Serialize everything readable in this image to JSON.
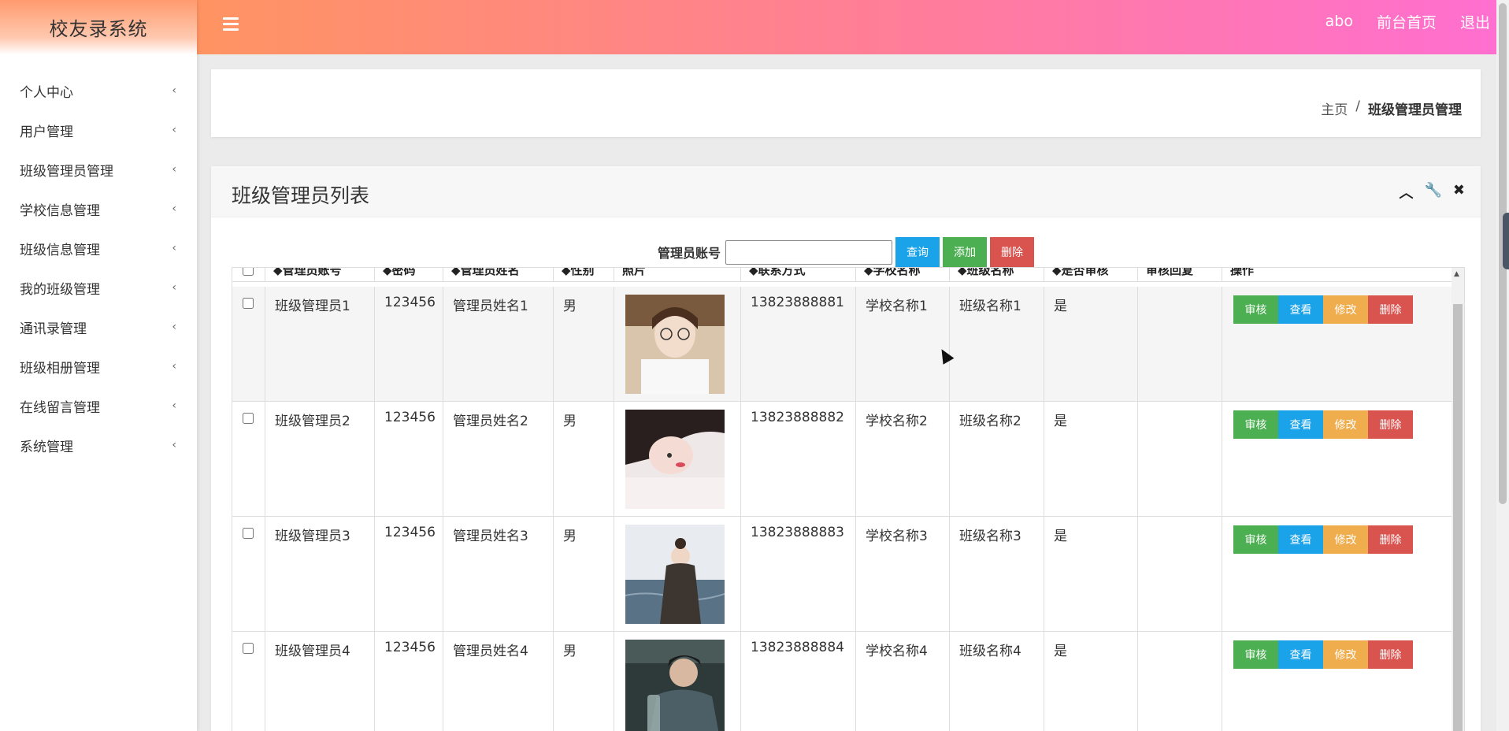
{
  "app": {
    "title": "校友录系统"
  },
  "sidebar": {
    "items": [
      {
        "label": "个人中心"
      },
      {
        "label": "用户管理"
      },
      {
        "label": "班级管理员管理"
      },
      {
        "label": "学校信息管理"
      },
      {
        "label": "班级信息管理"
      },
      {
        "label": "我的班级管理"
      },
      {
        "label": "通讯录管理"
      },
      {
        "label": "班级相册管理"
      },
      {
        "label": "在线留言管理"
      },
      {
        "label": "系统管理"
      }
    ],
    "chevron": "‹"
  },
  "header": {
    "user": "abo",
    "home_link": "前台首页",
    "logout": "退出"
  },
  "breadcrumb": {
    "home": "主页",
    "separator": "/",
    "current": "班级管理员管理"
  },
  "list": {
    "title": "班级管理员列表",
    "search": {
      "label": "管理员账号",
      "value": "",
      "query_btn": "查询",
      "add_btn": "添加",
      "delete_btn": "删除"
    },
    "columns": [
      "",
      "◆管理员账号",
      "◆密码",
      "◆管理员姓名",
      "◆性别",
      "照片",
      "◆联系方式",
      "◆学校名称",
      "◆班级名称",
      "◆是否审核",
      "审核回复",
      "操作"
    ],
    "rows": [
      {
        "account": "班级管理员1",
        "password": "123456",
        "name": "管理员姓名1",
        "gender": "男",
        "phone": "13823888881",
        "school": "学校名称1",
        "class": "班级名称1",
        "audited": "是",
        "reply": ""
      },
      {
        "account": "班级管理员2",
        "password": "123456",
        "name": "管理员姓名2",
        "gender": "男",
        "phone": "13823888882",
        "school": "学校名称2",
        "class": "班级名称2",
        "audited": "是",
        "reply": ""
      },
      {
        "account": "班级管理员3",
        "password": "123456",
        "name": "管理员姓名3",
        "gender": "男",
        "phone": "13823888883",
        "school": "学校名称3",
        "class": "班级名称3",
        "audited": "是",
        "reply": ""
      },
      {
        "account": "班级管理员4",
        "password": "123456",
        "name": "管理员姓名4",
        "gender": "男",
        "phone": "13823888884",
        "school": "学校名称4",
        "class": "班级名称4",
        "audited": "是",
        "reply": ""
      }
    ],
    "actions": {
      "audit": "审核",
      "view": "查看",
      "edit": "修改",
      "delete": "删除"
    }
  },
  "colors": {
    "green": "#4cb052",
    "blue": "#1aa3e8",
    "orange": "#f0ad4e",
    "red": "#d9534f"
  }
}
